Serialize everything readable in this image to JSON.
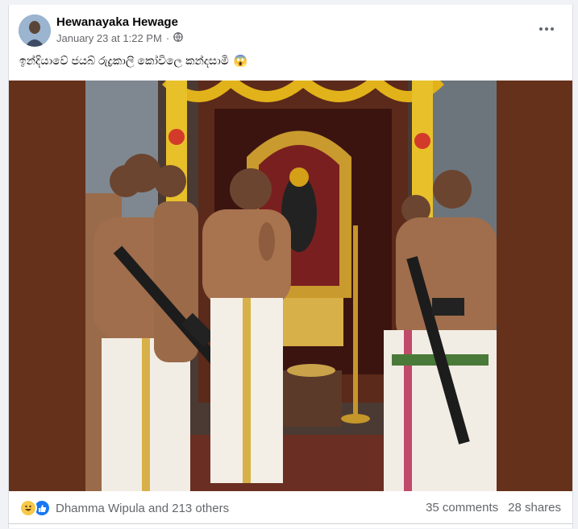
{
  "post": {
    "author": "Hewanayaka Hewage",
    "timestamp": "January 23 at 1:22 PM",
    "separator": "·",
    "privacy_icon": "globe-icon",
    "more_icon": "more-options-icon",
    "caption": "ඉන්දියාවේ ජයබ් රුද්‍රකාලි කෝවිලෙ කන්දසාමි",
    "caption_emoji": "😱"
  },
  "reactions": {
    "icons": [
      "haha-reaction-icon",
      "like-reaction-icon"
    ],
    "summary": "Dhamma Wipula and 213 others",
    "comments": "35 comments",
    "shares": "28 shares"
  },
  "colors": {
    "media_background": "#66311b",
    "like_blue": "#1877f2",
    "haha_yellow": "#f7c948",
    "meta_gray": "#65676b"
  }
}
